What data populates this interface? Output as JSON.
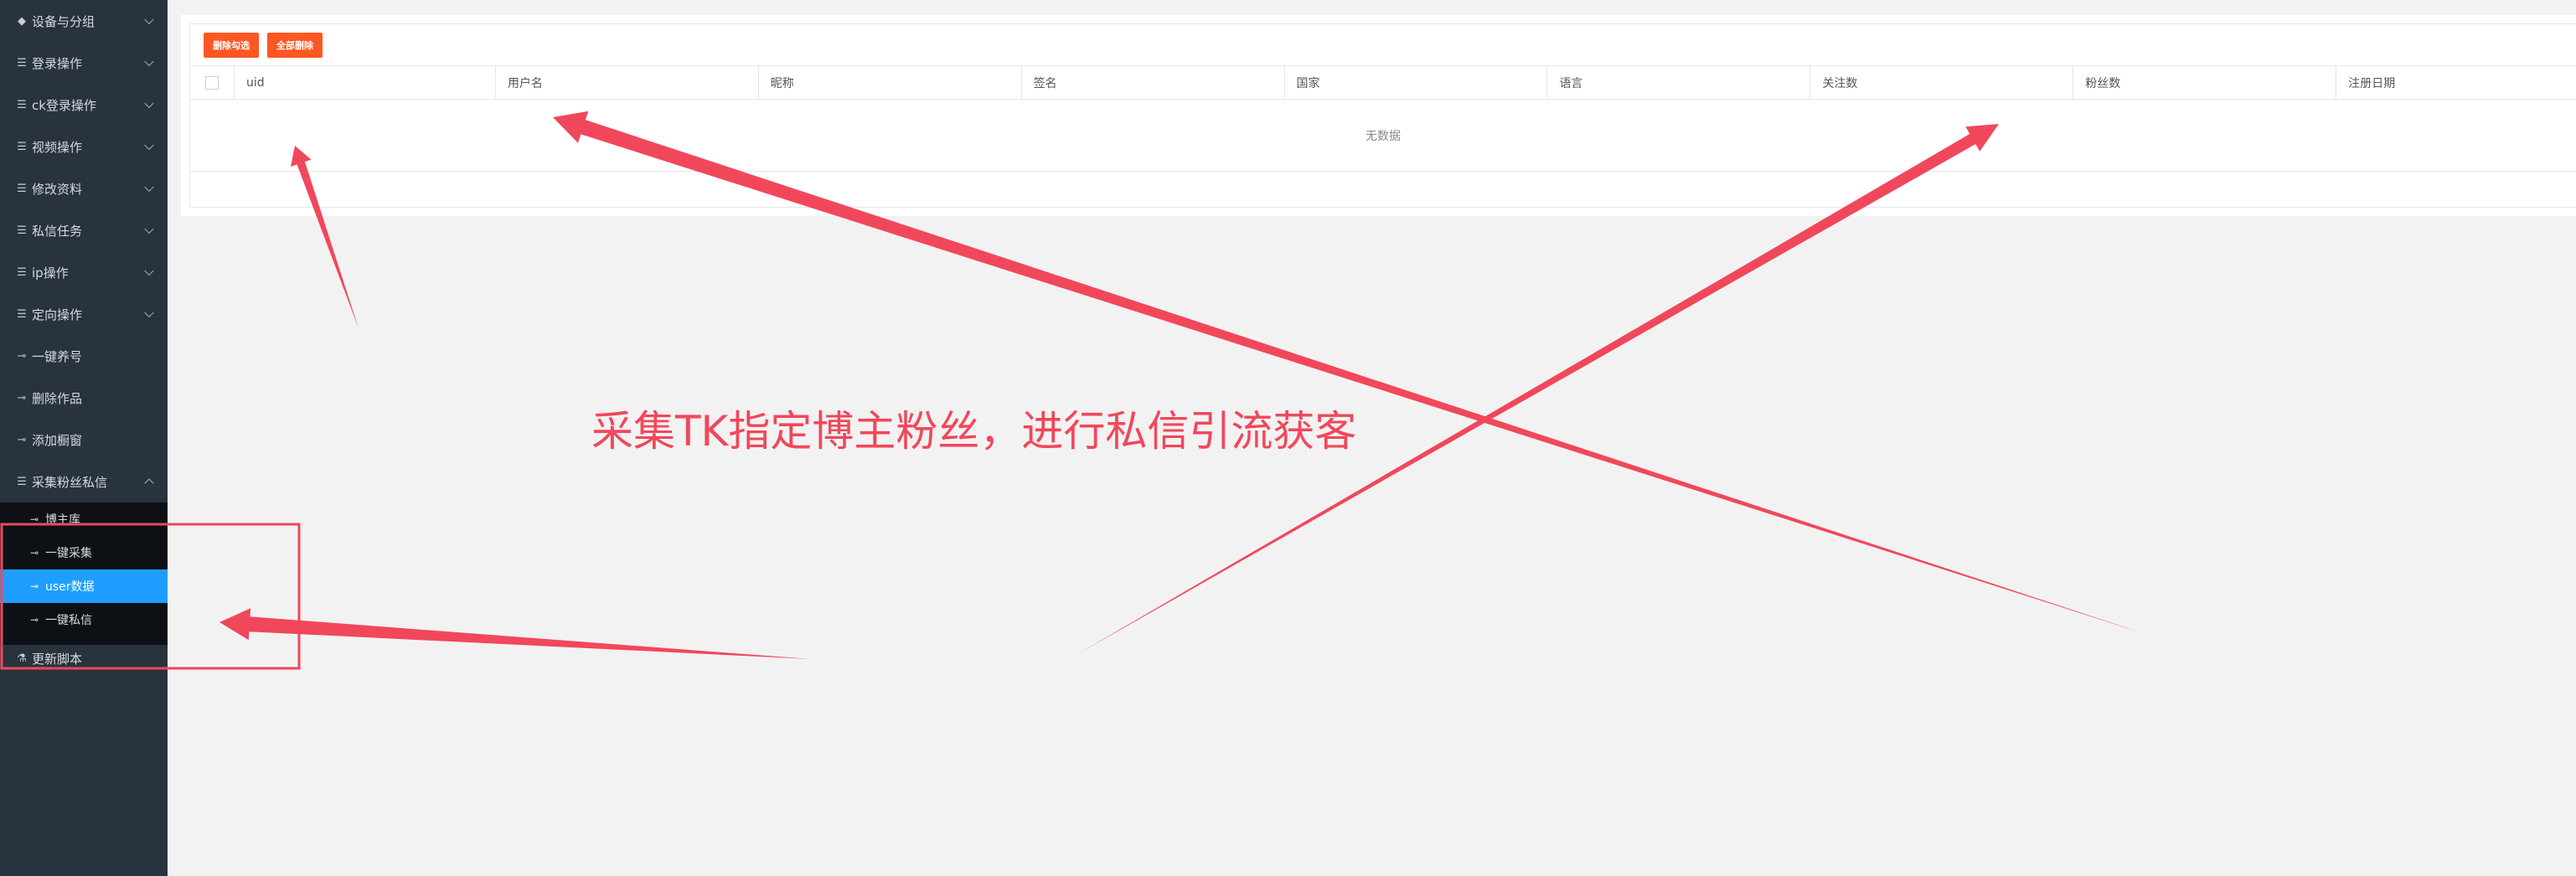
{
  "sidebar": {
    "items": [
      {
        "icon": "diamond-icon",
        "glyph": "◆",
        "label": "设备与分组",
        "chevron": "down"
      },
      {
        "icon": "list-icon",
        "glyph": "☰",
        "label": "登录操作",
        "chevron": "down"
      },
      {
        "icon": "list-icon",
        "glyph": "☰",
        "label": "ck登录操作",
        "chevron": "down"
      },
      {
        "icon": "list-icon",
        "glyph": "☰",
        "label": "视频操作",
        "chevron": "down"
      },
      {
        "icon": "list-icon",
        "glyph": "☰",
        "label": "修改资料",
        "chevron": "down"
      },
      {
        "icon": "list-icon",
        "glyph": "☰",
        "label": "私信任务",
        "chevron": "down"
      },
      {
        "icon": "list-icon",
        "glyph": "☰",
        "label": "ip操作",
        "chevron": "down"
      },
      {
        "icon": "list-icon",
        "glyph": "☰",
        "label": "定向操作",
        "chevron": "down"
      },
      {
        "icon": "plug-icon",
        "glyph": "⊸",
        "label": "一键养号"
      },
      {
        "icon": "plug-icon",
        "glyph": "⊸",
        "label": "删除作品"
      },
      {
        "icon": "plug-icon",
        "glyph": "⊸",
        "label": "添加橱窗"
      },
      {
        "icon": "list-icon",
        "glyph": "☰",
        "label": "采集粉丝私信",
        "chevron": "up"
      }
    ],
    "submenu": [
      {
        "icon": "plug-icon",
        "glyph": "⊸",
        "label": "博主库"
      },
      {
        "icon": "plug-icon",
        "glyph": "⊸",
        "label": "一键采集"
      },
      {
        "icon": "plug-icon",
        "glyph": "⊸",
        "label": "user数据",
        "active": true
      },
      {
        "icon": "plug-icon",
        "glyph": "⊸",
        "label": "一键私信"
      }
    ],
    "footer_item": {
      "icon": "flask-icon",
      "glyph": "⚗",
      "label": "更新脚本"
    }
  },
  "toolbar": {
    "delete_selected_label": "删除勾选",
    "delete_all_label": "全部删除",
    "button_color": "#ff5722"
  },
  "table": {
    "columns": [
      "uid",
      "用户名",
      "昵称",
      "签名",
      "国家",
      "语言",
      "关注数",
      "粉丝数",
      "注册日期"
    ],
    "empty_text": "无数据"
  },
  "annotation": {
    "caption": "采集TK指定博主粉丝，进行私信引流获客",
    "color": "#f1475b"
  },
  "colors": {
    "sidebar_bg": "#28333e",
    "submenu_bg": "#0d1116",
    "active_bg": "#1e9fff",
    "page_bg": "#f2f2f2"
  }
}
